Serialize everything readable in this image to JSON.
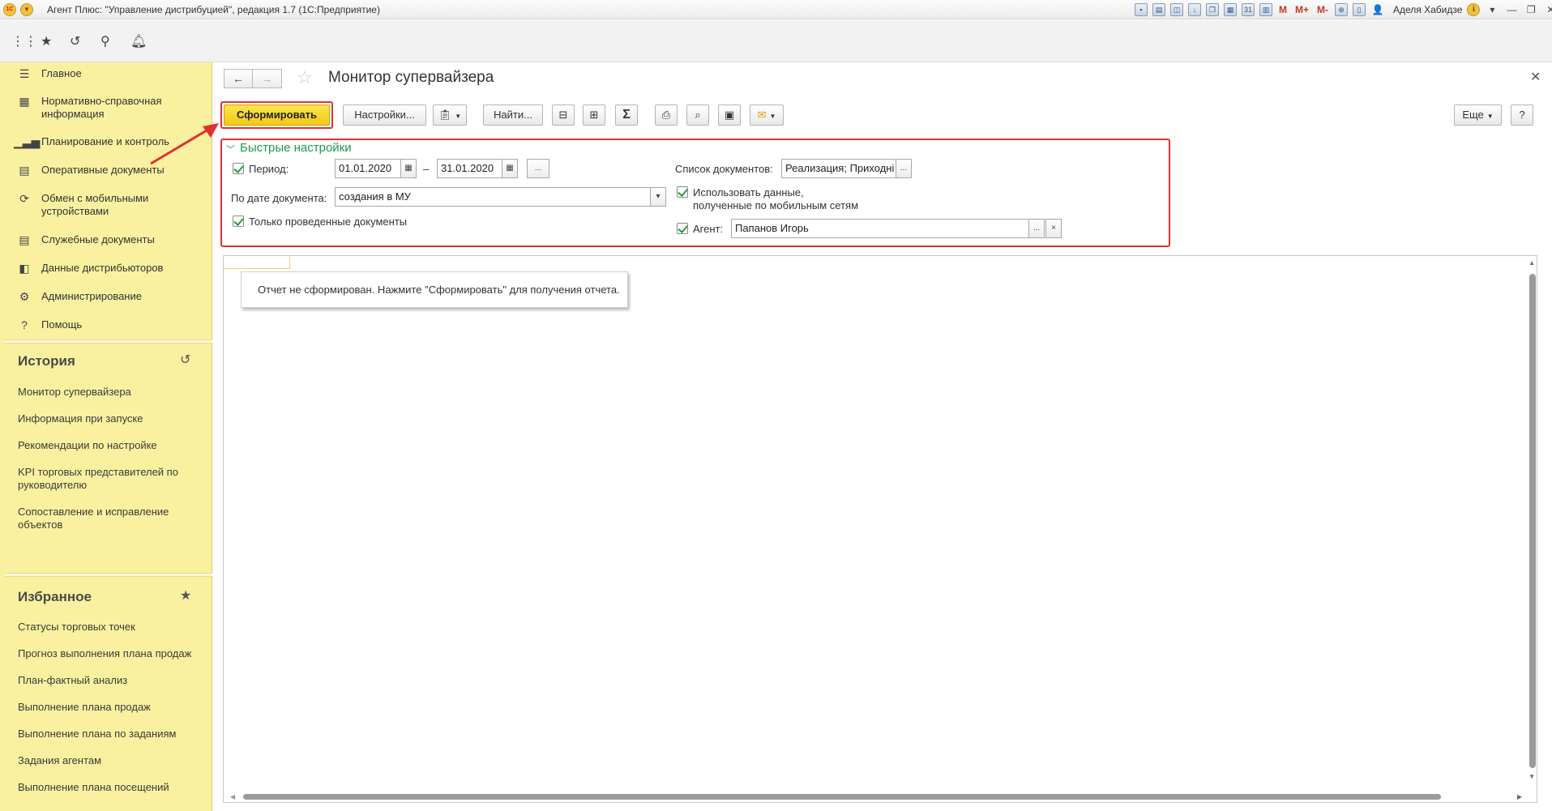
{
  "window": {
    "title": "Агент Плюс: \"Управление дистрибуцией\", редакция 1.7  (1С:Предприятие)",
    "user": "Аделя Хабидзе",
    "m_labels": [
      "M",
      "M+",
      "M-"
    ]
  },
  "sidebar": {
    "nav": [
      {
        "label": "Главное",
        "icon": "menu-icon"
      },
      {
        "label": "Нормативно-справочная информация",
        "icon": "table-icon"
      },
      {
        "label": "Планирование и контроль",
        "icon": "bar-chart-icon"
      },
      {
        "label": "Оперативные документы",
        "icon": "documents-icon"
      },
      {
        "label": "Обмен с мобильными устройствами",
        "icon": "sync-icon"
      },
      {
        "label": "Служебные документы",
        "icon": "documents-icon"
      },
      {
        "label": "Данные дистрибьюторов",
        "icon": "chart-icon"
      },
      {
        "label": "Администрирование",
        "icon": "gear-icon"
      },
      {
        "label": "Помощь",
        "icon": "help-icon"
      }
    ],
    "history": {
      "title": "История",
      "items": [
        "Монитор супервайзера",
        "Информация при запуске",
        "Рекомендации по настройке",
        "KPI торговых представителей по руководителю",
        "Сопоставление и исправление объектов"
      ]
    },
    "favorites": {
      "title": "Избранное",
      "items": [
        "Статусы торговых точек",
        "Прогноз выполнения плана продаж",
        "План-фактный анализ",
        "Выполнение плана продаж",
        "Выполнение плана по заданиям",
        "Задания агентам",
        "Выполнение плана посещений"
      ]
    }
  },
  "page": {
    "title": "Монитор супервайзера",
    "toolbar": {
      "generate": "Сформировать",
      "settings": "Настройки...",
      "find": "Найти...",
      "more": "Еще",
      "help": "?"
    },
    "quick_settings": {
      "title": "Быстрые настройки",
      "period_label": "Период:",
      "date_from": "01.01.2020",
      "dash": "–",
      "date_to": "31.01.2020",
      "ellipsis": "...",
      "by_date_label": "По дате документа:",
      "by_date_value": "создания в МУ",
      "only_posted": "Только проведенные документы",
      "doc_list_label": "Список документов:",
      "doc_list_value": "Реализация; Приходні",
      "use_mobile_1": "Использовать данные,",
      "use_mobile_2": "полученные по мобильным сетям",
      "agent_label": "Агент:",
      "agent_value": "Папанов Игорь",
      "clear": "×"
    },
    "report_notice": "Отчет не сформирован. Нажмите \"Сформировать\" для получения отчета."
  },
  "colors": {
    "sidebar_bg": "#faf1a0",
    "primary_button": "#f2c915",
    "highlight_red": "#e03131",
    "accent_green": "#1e9a4b"
  }
}
